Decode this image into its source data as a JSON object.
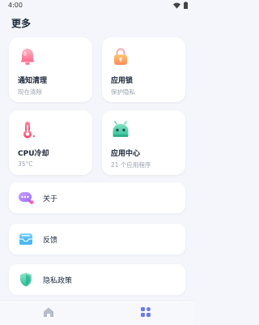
{
  "status_bar": {
    "time": "4:00"
  },
  "page": {
    "title": "更多"
  },
  "cards": [
    {
      "title": "通知清理",
      "subtitle": "现在清除",
      "icon": "bell-icon"
    },
    {
      "title": "应用锁",
      "subtitle": "保护隐私",
      "icon": "lock-icon"
    },
    {
      "title": "CPU冷却",
      "subtitle": "35°C",
      "icon": "thermometer-icon"
    },
    {
      "title": "应用中心",
      "subtitle": "21 个应用程序",
      "icon": "android-icon"
    }
  ],
  "list": [
    {
      "label": "关于",
      "icon": "chat-bubble-icon"
    },
    {
      "label": "反馈",
      "icon": "inbox-icon"
    },
    {
      "label": "隐私政策",
      "icon": "shield-icon"
    }
  ],
  "bottom_nav": [
    {
      "icon": "home-icon",
      "active": false
    },
    {
      "icon": "apps-grid-icon",
      "active": true
    }
  ],
  "colors": {
    "accent": "#6c7de8",
    "inactive": "#b6bcc8",
    "background": "#f4f6fb"
  }
}
